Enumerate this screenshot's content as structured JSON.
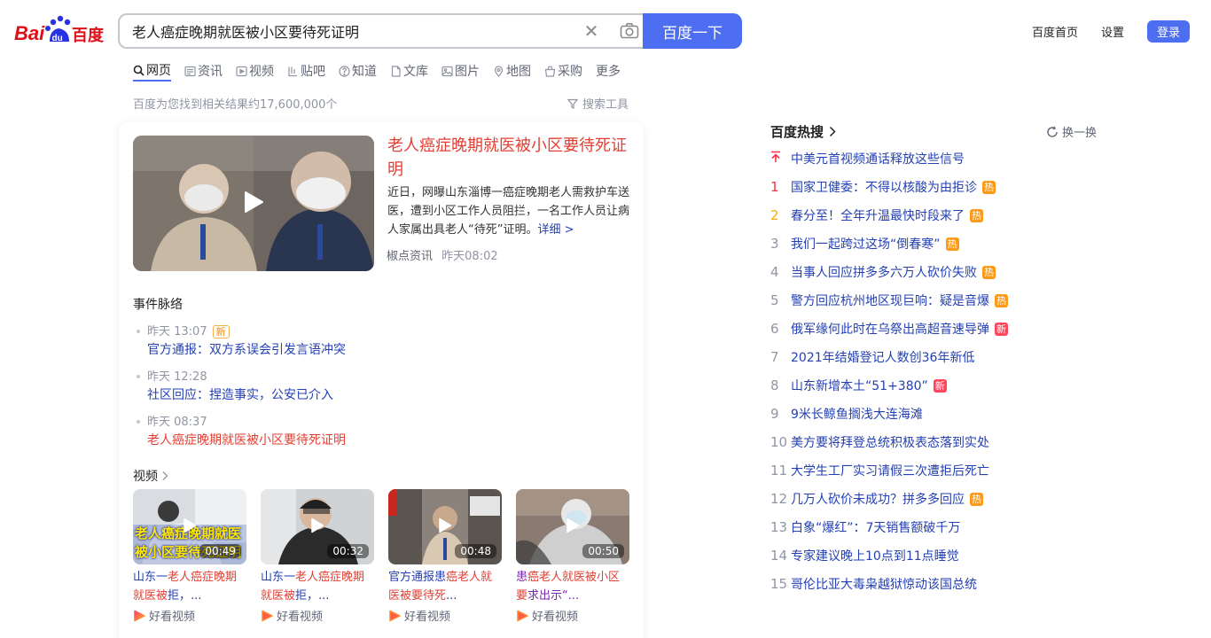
{
  "logo_text": "Bai du 百度",
  "search": {
    "query": "老人癌症晚期就医被小区要待死证明",
    "button_label": "百度一下"
  },
  "top_links": {
    "home": "百度首页",
    "settings": "设置",
    "login": "登录"
  },
  "tabs": [
    {
      "label": "网页",
      "icon": "search-icon"
    },
    {
      "label": "资讯",
      "icon": "news-icon"
    },
    {
      "label": "视频",
      "icon": "video-icon"
    },
    {
      "label": "贴吧",
      "icon": "tieba-icon"
    },
    {
      "label": "知道",
      "icon": "question-icon"
    },
    {
      "label": "文库",
      "icon": "document-icon"
    },
    {
      "label": "图片",
      "icon": "image-icon"
    },
    {
      "label": "地图",
      "icon": "map-icon"
    },
    {
      "label": "采购",
      "icon": "shop-icon"
    },
    {
      "label": "更多",
      "icon": ""
    }
  ],
  "result_count": "百度为您找到相关结果约17,600,000个",
  "search_tools": "搜索工具",
  "news": {
    "title": "老人癌症晚期就医被小区要待死证明",
    "abstract": "近日，网曝山东淄博一癌症晚期老人需救护车送医，遭到小区工作人员阻拦，一名工作人员让病人家属出具老人“待死”证明。",
    "more": "详细 >",
    "source": "椒点资讯",
    "time": "昨天08:02"
  },
  "events": {
    "title": "事件脉络",
    "items": [
      {
        "time": "昨天 13:07",
        "badge": "新",
        "text": "官方通报：双方系误会引发言语冲突"
      },
      {
        "time": "昨天 12:28",
        "text": "社区回应：捏造事实，公安已介入"
      },
      {
        "time": "昨天 08:37",
        "text": "老人癌症晚期就医被小区要待死证明"
      }
    ]
  },
  "videos": {
    "title": "视频",
    "items": [
      {
        "duration": "00:49",
        "cap_a": "山东一",
        "cap_hl": "老人癌症晚期就医被",
        "cap_b": "拒，...",
        "thumb_text": "老人癌症晚期就医 被小区要待死证明",
        "source": "好看视频"
      },
      {
        "duration": "00:32",
        "cap_a": "山东一",
        "cap_hl": "老人癌症晚期就医被",
        "cap_b": "拒，...",
        "source": "好看视频"
      },
      {
        "duration": "00:48",
        "cap_a": "官方通报患",
        "cap_hl": "癌老人就医被要待死",
        "cap_b": "...",
        "source": "好看视频"
      },
      {
        "duration": "00:50",
        "cap_a": "患",
        "cap_hl": "癌老人就医被小区要",
        "cap_b": "求出示“...",
        "source": "好看视频"
      }
    ]
  },
  "hot": {
    "title": "百度热搜",
    "refresh": "换一换",
    "items": [
      {
        "rank": "",
        "text": "中美元首视频通话释放这些信号",
        "tag": ""
      },
      {
        "rank": "1",
        "text": "国家卫健委：不得以核酸为由拒诊",
        "tag": "热"
      },
      {
        "rank": "2",
        "text": "春分至！全年升温最快时段来了",
        "tag": "热"
      },
      {
        "rank": "3",
        "text": "我们一起跨过这场“倒春寒”",
        "tag": "热"
      },
      {
        "rank": "4",
        "text": "当事人回应拼多多六万人砍价失败",
        "tag": "热"
      },
      {
        "rank": "5",
        "text": "警方回应杭州地区现巨响：疑是音爆",
        "tag": "热"
      },
      {
        "rank": "6",
        "text": "俄军缘何此时在乌祭出高超音速导弹",
        "tag": "新"
      },
      {
        "rank": "7",
        "text": "2021年结婚登记人数创36年新低",
        "tag": ""
      },
      {
        "rank": "8",
        "text": "山东新增本土“51+380”",
        "tag": "新"
      },
      {
        "rank": "9",
        "text": "9米长鲸鱼搁浅大连海滩",
        "tag": ""
      },
      {
        "rank": "10",
        "text": "美方要将拜登总统积极表态落到实处",
        "tag": ""
      },
      {
        "rank": "11",
        "text": "大学生工厂实习请假三次遭拒后死亡",
        "tag": ""
      },
      {
        "rank": "12",
        "text": "几万人砍价未成功？拼多多回应",
        "tag": "热"
      },
      {
        "rank": "13",
        "text": "白象“爆红”：7天销售额破千万",
        "tag": ""
      },
      {
        "rank": "14",
        "text": "专家建议晚上10点到11点睡觉",
        "tag": ""
      },
      {
        "rank": "15",
        "text": "哥伦比亚大毒枭越狱惊动该国总统",
        "tag": ""
      }
    ]
  }
}
